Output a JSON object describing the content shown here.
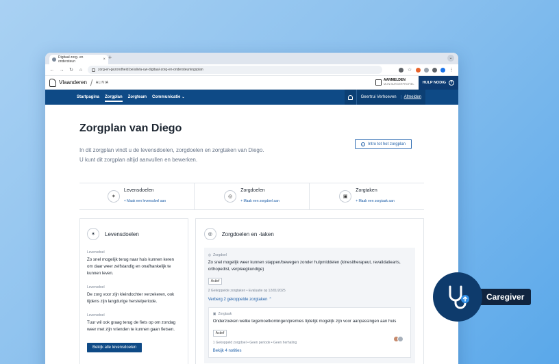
{
  "browser": {
    "tab_title": "Digitaal zorg- en ondersteun",
    "url": "zorg-en-gezondheid.be/alivia-uw-digitaal-zorg-en-ondersteuningsplan"
  },
  "site_header": {
    "brand": "Vlaanderen",
    "product": "ALIVIA",
    "login_label": "AANMELDEN",
    "login_sub": "MIJN BURGERPROFIEL",
    "help_label": "HULP NODIG"
  },
  "main_nav": {
    "items": [
      "Startpagina",
      "Zorgplan",
      "Zorgteam",
      "Communicatie"
    ],
    "user_name": "Geertrui Verhoeven",
    "logout_label": "Afmelden"
  },
  "page": {
    "title": "Zorgplan van Diego",
    "intro_button": "Intro tot het zorgplan",
    "description_line1": "In dit zorgplan vindt u de levensdoelen, zorgdoelen en zorgtaken van Diego.",
    "description_line2": "U kunt dit zorgplan altijd aanvullen en bewerken."
  },
  "summary": [
    {
      "title": "Levensdoelen",
      "action": "+ Maak een levensdoel aan"
    },
    {
      "title": "Zorgdoelen",
      "action": "+ Maak een zorgdoel aan"
    },
    {
      "title": "Zorgtaken",
      "action": "+ Maak een zorgtaak aan"
    }
  ],
  "levensdoelen_panel": {
    "title": "Levensdoelen",
    "goals": [
      {
        "label": "Levensdoel",
        "text": "Zo snel mogelijk terug naar huis kunnen keren om daar weer zelfstandig en onafhankelijk te kunnen leven."
      },
      {
        "label": "Levensdoel",
        "text": "De zorg voor zijn kleindochter verzekeren, ook tijdens zijn langdurige herstelperiode."
      },
      {
        "label": "Levensdoel",
        "text": "Tuur wil ook graag terug de fiets op om zondag weer met zijn vrienden te kunnen gaan fietsen."
      }
    ],
    "button": "Bekijk alle levensdoelen"
  },
  "zorgdoelen_panel": {
    "title": "Zorgdoelen en -taken",
    "zorgdoel": {
      "label": "Zorgdoel",
      "text": "Zo snel mogelijk weer kunnen stappen/bewegen zonder hulpmiddelen (kinesitherapeut, revalidatiearts, orthopedist, verpleegkundige)",
      "status": "Actief",
      "meta": "2 Gekoppelde zorgtaken • Evaluatie op 12/01/2025",
      "toggle_link": "Verberg 2 gekoppelde zorgtaken"
    },
    "zorgtaak": {
      "label": "Zorgtaak",
      "text": "Onderzoeken welke tegemoetkomingen/premies tijdelijk mogelijk zijn voor aanpassingen aan huis",
      "status": "Actief",
      "meta": "1 Gekoppeld zorgdoel • Geen periode • Geen herhaling",
      "notes_link": "Bekijk 4 notities"
    }
  },
  "overlay": {
    "label": "Caregiver",
    "icon": "stethoscope-icon",
    "colors": {
      "circle": "#0e3b6c",
      "label_bg": "#10243f",
      "accent": "#2f8ee5"
    }
  }
}
